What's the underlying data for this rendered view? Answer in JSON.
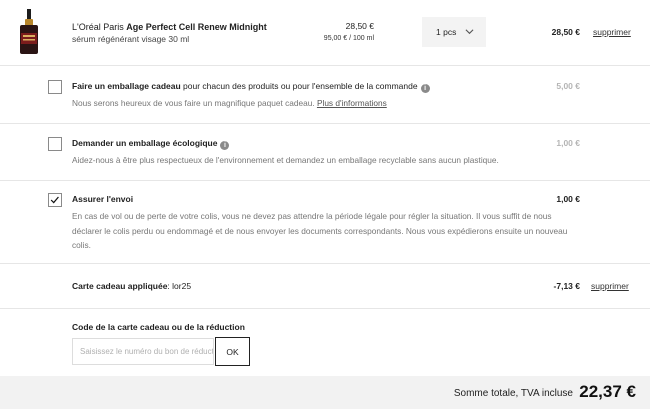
{
  "product": {
    "brand": "L'Oréal Paris",
    "name": "Age Perfect Cell Renew Midnight",
    "subtitle": "sérum régénérant visage 30 ml",
    "unit_price": "28,50 €",
    "price_per": "95,00 € / 100 ml",
    "quantity": "1 pcs",
    "line_total": "28,50 €",
    "remove_label": "supprimer"
  },
  "options": {
    "gift_wrap": {
      "checked": false,
      "title": "Faire un emballage cadeau",
      "title_rest": " pour chacun des produits ou pour l'ensemble de la commande",
      "description": "Nous serons heureux de vous faire un magnifique paquet cadeau.",
      "link": "Plus d'informations",
      "price": "5,00 €"
    },
    "eco_wrap": {
      "checked": false,
      "title": "Demander un emballage écologique",
      "description": "Aidez-nous à être plus respectueux de l'environnement et demandez un emballage recyclable sans aucun plastique.",
      "price": "1,00 €"
    },
    "insurance": {
      "checked": true,
      "title": "Assurer l'envoi",
      "description": "En cas de vol ou de perte de votre colis, vous ne devez pas attendre la période légale pour régler la situation. Il vous suffit de nous déclarer le colis perdu ou endommagé et de nous envoyer les documents correspondants. Nous vous expédierons ensuite un nouveau colis.",
      "price": "1,00 €"
    }
  },
  "gift_card": {
    "label": "Carte cadeau appliquée",
    "code": ": lor25",
    "amount": "-7,13 €",
    "remove_label": "supprimer"
  },
  "voucher": {
    "label": "Code de la carte cadeau ou de la réduction",
    "placeholder": "Saisissez le numéro du bon de réduction",
    "button": "OK"
  },
  "total": {
    "label": "Somme totale, TVA incluse",
    "amount": "22,37 €"
  },
  "colors": {
    "text": "#222222",
    "muted": "#b5b5b5",
    "footer_bg": "#f2f2f2"
  },
  "icons": [
    "serum-bottle-icon",
    "chevron-down-icon",
    "info-icon",
    "checkmark-icon"
  ]
}
